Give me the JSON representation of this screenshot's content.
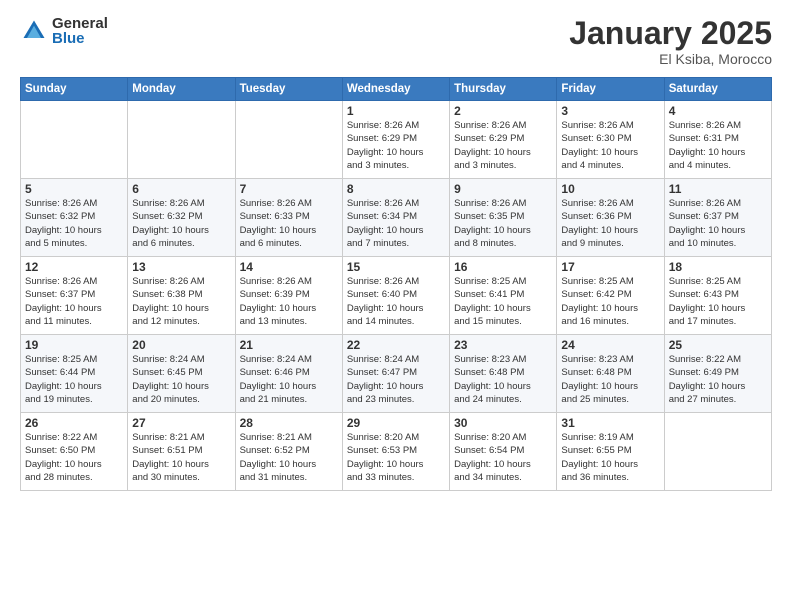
{
  "header": {
    "logo_general": "General",
    "logo_blue": "Blue",
    "month_title": "January 2025",
    "subtitle": "El Ksiba, Morocco"
  },
  "days_of_week": [
    "Sunday",
    "Monday",
    "Tuesday",
    "Wednesday",
    "Thursday",
    "Friday",
    "Saturday"
  ],
  "weeks": [
    [
      {
        "day": "",
        "info": ""
      },
      {
        "day": "",
        "info": ""
      },
      {
        "day": "",
        "info": ""
      },
      {
        "day": "1",
        "info": "Sunrise: 8:26 AM\nSunset: 6:29 PM\nDaylight: 10 hours\nand 3 minutes."
      },
      {
        "day": "2",
        "info": "Sunrise: 8:26 AM\nSunset: 6:29 PM\nDaylight: 10 hours\nand 3 minutes."
      },
      {
        "day": "3",
        "info": "Sunrise: 8:26 AM\nSunset: 6:30 PM\nDaylight: 10 hours\nand 4 minutes."
      },
      {
        "day": "4",
        "info": "Sunrise: 8:26 AM\nSunset: 6:31 PM\nDaylight: 10 hours\nand 4 minutes."
      }
    ],
    [
      {
        "day": "5",
        "info": "Sunrise: 8:26 AM\nSunset: 6:32 PM\nDaylight: 10 hours\nand 5 minutes."
      },
      {
        "day": "6",
        "info": "Sunrise: 8:26 AM\nSunset: 6:32 PM\nDaylight: 10 hours\nand 6 minutes."
      },
      {
        "day": "7",
        "info": "Sunrise: 8:26 AM\nSunset: 6:33 PM\nDaylight: 10 hours\nand 6 minutes."
      },
      {
        "day": "8",
        "info": "Sunrise: 8:26 AM\nSunset: 6:34 PM\nDaylight: 10 hours\nand 7 minutes."
      },
      {
        "day": "9",
        "info": "Sunrise: 8:26 AM\nSunset: 6:35 PM\nDaylight: 10 hours\nand 8 minutes."
      },
      {
        "day": "10",
        "info": "Sunrise: 8:26 AM\nSunset: 6:36 PM\nDaylight: 10 hours\nand 9 minutes."
      },
      {
        "day": "11",
        "info": "Sunrise: 8:26 AM\nSunset: 6:37 PM\nDaylight: 10 hours\nand 10 minutes."
      }
    ],
    [
      {
        "day": "12",
        "info": "Sunrise: 8:26 AM\nSunset: 6:37 PM\nDaylight: 10 hours\nand 11 minutes."
      },
      {
        "day": "13",
        "info": "Sunrise: 8:26 AM\nSunset: 6:38 PM\nDaylight: 10 hours\nand 12 minutes."
      },
      {
        "day": "14",
        "info": "Sunrise: 8:26 AM\nSunset: 6:39 PM\nDaylight: 10 hours\nand 13 minutes."
      },
      {
        "day": "15",
        "info": "Sunrise: 8:26 AM\nSunset: 6:40 PM\nDaylight: 10 hours\nand 14 minutes."
      },
      {
        "day": "16",
        "info": "Sunrise: 8:25 AM\nSunset: 6:41 PM\nDaylight: 10 hours\nand 15 minutes."
      },
      {
        "day": "17",
        "info": "Sunrise: 8:25 AM\nSunset: 6:42 PM\nDaylight: 10 hours\nand 16 minutes."
      },
      {
        "day": "18",
        "info": "Sunrise: 8:25 AM\nSunset: 6:43 PM\nDaylight: 10 hours\nand 17 minutes."
      }
    ],
    [
      {
        "day": "19",
        "info": "Sunrise: 8:25 AM\nSunset: 6:44 PM\nDaylight: 10 hours\nand 19 minutes."
      },
      {
        "day": "20",
        "info": "Sunrise: 8:24 AM\nSunset: 6:45 PM\nDaylight: 10 hours\nand 20 minutes."
      },
      {
        "day": "21",
        "info": "Sunrise: 8:24 AM\nSunset: 6:46 PM\nDaylight: 10 hours\nand 21 minutes."
      },
      {
        "day": "22",
        "info": "Sunrise: 8:24 AM\nSunset: 6:47 PM\nDaylight: 10 hours\nand 23 minutes."
      },
      {
        "day": "23",
        "info": "Sunrise: 8:23 AM\nSunset: 6:48 PM\nDaylight: 10 hours\nand 24 minutes."
      },
      {
        "day": "24",
        "info": "Sunrise: 8:23 AM\nSunset: 6:48 PM\nDaylight: 10 hours\nand 25 minutes."
      },
      {
        "day": "25",
        "info": "Sunrise: 8:22 AM\nSunset: 6:49 PM\nDaylight: 10 hours\nand 27 minutes."
      }
    ],
    [
      {
        "day": "26",
        "info": "Sunrise: 8:22 AM\nSunset: 6:50 PM\nDaylight: 10 hours\nand 28 minutes."
      },
      {
        "day": "27",
        "info": "Sunrise: 8:21 AM\nSunset: 6:51 PM\nDaylight: 10 hours\nand 30 minutes."
      },
      {
        "day": "28",
        "info": "Sunrise: 8:21 AM\nSunset: 6:52 PM\nDaylight: 10 hours\nand 31 minutes."
      },
      {
        "day": "29",
        "info": "Sunrise: 8:20 AM\nSunset: 6:53 PM\nDaylight: 10 hours\nand 33 minutes."
      },
      {
        "day": "30",
        "info": "Sunrise: 8:20 AM\nSunset: 6:54 PM\nDaylight: 10 hours\nand 34 minutes."
      },
      {
        "day": "31",
        "info": "Sunrise: 8:19 AM\nSunset: 6:55 PM\nDaylight: 10 hours\nand 36 minutes."
      },
      {
        "day": "",
        "info": ""
      }
    ]
  ]
}
